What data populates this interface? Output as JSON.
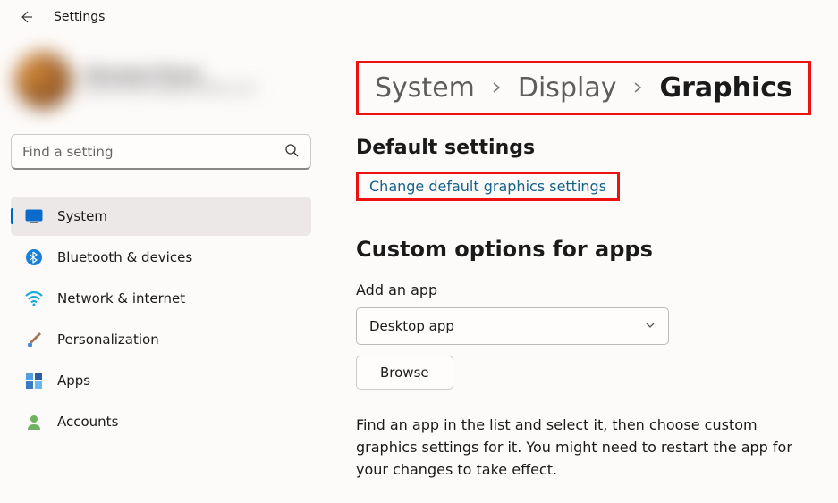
{
  "app_title": "Settings",
  "profile": {
    "name": "Giovanni Flores",
    "sub": "giovanniflores@example.com"
  },
  "search": {
    "placeholder": "Find a setting"
  },
  "nav": {
    "items": [
      {
        "label": "System"
      },
      {
        "label": "Bluetooth & devices"
      },
      {
        "label": "Network & internet"
      },
      {
        "label": "Personalization"
      },
      {
        "label": "Apps"
      },
      {
        "label": "Accounts"
      }
    ]
  },
  "breadcrumb": {
    "a": "System",
    "b": "Display",
    "c": "Graphics"
  },
  "default_section": {
    "title": "Default settings",
    "link": "Change default graphics settings"
  },
  "custom_section": {
    "title": "Custom options for apps",
    "add_label": "Add an app",
    "dropdown_value": "Desktop app",
    "browse_label": "Browse",
    "help": "Find an app in the list and select it, then choose custom graphics settings for it. You might need to restart the app for your changes to take effect."
  }
}
